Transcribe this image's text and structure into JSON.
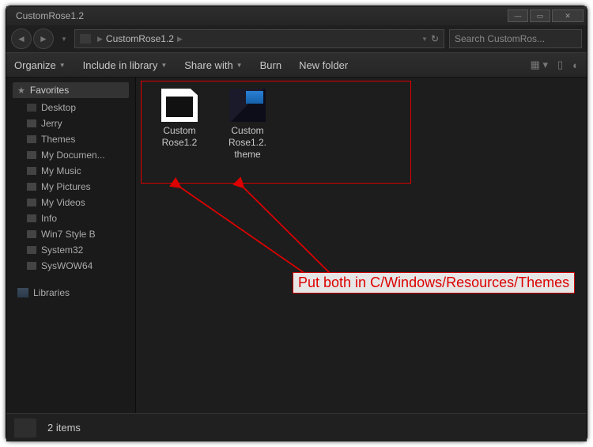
{
  "window": {
    "title": "CustomRose1.2"
  },
  "breadcrumb": {
    "current": "CustomRose1.2"
  },
  "search": {
    "placeholder": "Search CustomRos..."
  },
  "toolbar": {
    "organize": "Organize",
    "include": "Include in library",
    "share": "Share with",
    "burn": "Burn",
    "newfolder": "New folder"
  },
  "sidebar": {
    "favorites_label": "Favorites",
    "items": [
      {
        "label": "Desktop"
      },
      {
        "label": "Jerry"
      },
      {
        "label": "Themes"
      },
      {
        "label": "My Documen..."
      },
      {
        "label": "My Music"
      },
      {
        "label": "My Pictures"
      },
      {
        "label": "My Videos"
      },
      {
        "label": "Info"
      },
      {
        "label": "Win7 Style B"
      },
      {
        "label": "System32"
      },
      {
        "label": "SysWOW64"
      }
    ],
    "libraries_label": "Libraries"
  },
  "files": [
    {
      "name": "Custom\nRose1.2"
    },
    {
      "name": "Custom\nRose1.2.\ntheme"
    }
  ],
  "annotation": {
    "text": "Put both in C/Windows/Resources/Themes"
  },
  "status": {
    "count": "2 items"
  }
}
